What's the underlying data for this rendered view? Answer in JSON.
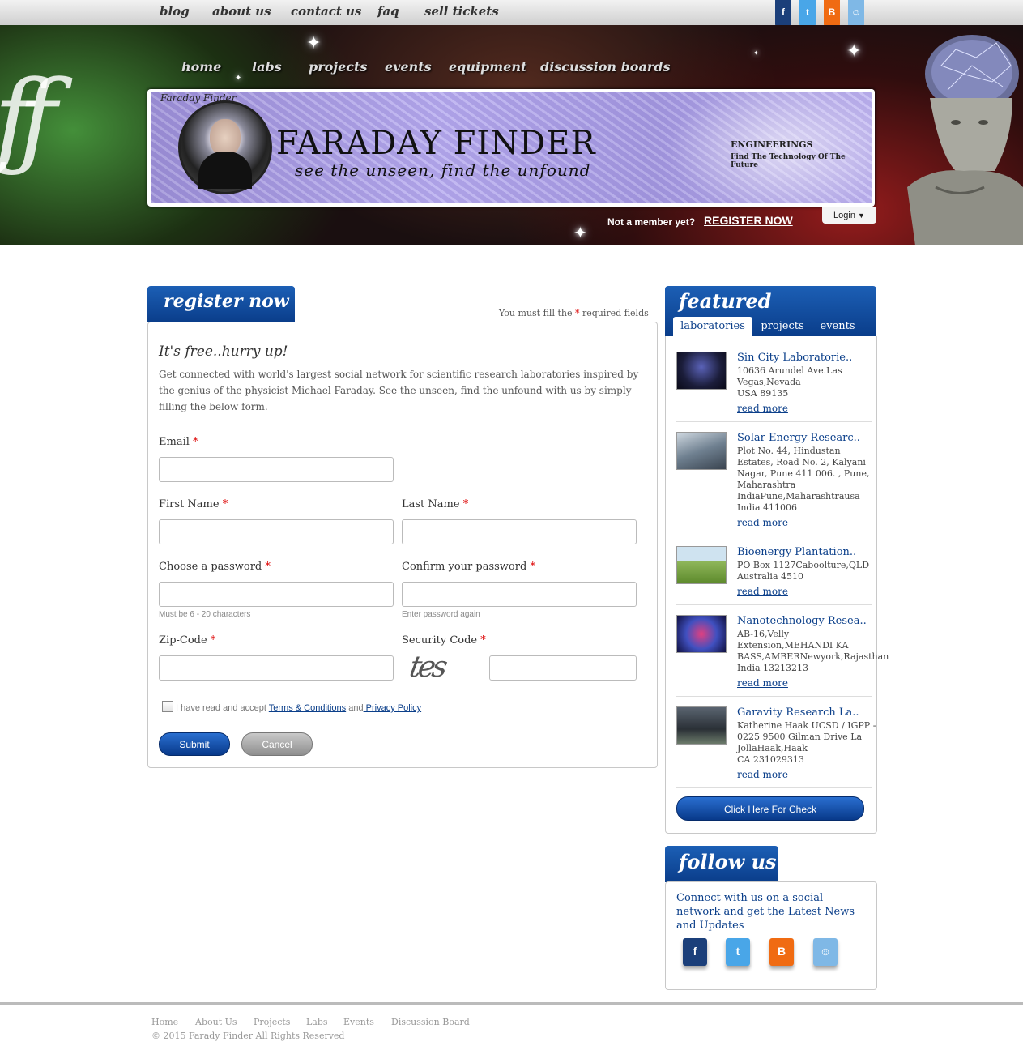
{
  "top_nav": {
    "items": [
      "blog",
      "about us",
      "contact us",
      "faq",
      "sell tickets"
    ]
  },
  "social_top": [
    {
      "icon": "facebook-icon",
      "glyph": "f",
      "color": "#1b3f7a"
    },
    {
      "icon": "twitter-icon",
      "glyph": "t",
      "color": "#49a6e8"
    },
    {
      "icon": "blogger-icon",
      "glyph": "B",
      "color": "#f06b12"
    },
    {
      "icon": "reddit-icon",
      "glyph": "☺",
      "color": "#7fb8e6"
    }
  ],
  "main_nav": {
    "items": [
      "home",
      "labs",
      "projects",
      "events",
      "equipment",
      "discussion boards"
    ]
  },
  "banner": {
    "arc_text": "Faraday Finder",
    "brand": "FARADAY FINDER",
    "tagline": "see the unseen,  find the unfound",
    "section": "ENGINEERINGS",
    "section_sub": "Find The Technology Of The Future"
  },
  "header": {
    "member_text": "Not a member yet?",
    "register_link": "REGISTER NOW",
    "login_label": "Login"
  },
  "register": {
    "tab_title": "register now",
    "required_prefix": "You must fill the",
    "required_suffix": "required fields",
    "heading": "It's free..hurry up!",
    "intro": "Get connected with world's largest social network for scientific research laboratories inspired by the genius of the physicist Michael Faraday. See the unseen, find the unfound with us by simply filling the below form.",
    "fields": {
      "email": "Email",
      "first_name": "First Name",
      "last_name": "Last Name",
      "password": "Choose a password",
      "confirm_password": "Confirm your password",
      "zip": "Zip-Code",
      "security": "Security Code"
    },
    "password_hint": "Must be 6 - 20 characters",
    "confirm_hint": "Enter password again",
    "captcha_text": "tes",
    "accept_prefix": "I have read and accept",
    "terms_link": "Terms & Conditions",
    "and_text": "and",
    "privacy_link": " Privacy Policy",
    "submit": "Submit",
    "cancel": "Cancel"
  },
  "featured": {
    "title": "featured",
    "tabs": [
      "laboratories",
      "projects",
      "events"
    ],
    "active_tab": "laboratories",
    "items": [
      {
        "title": "Sin City Laboratorie..",
        "address": "10636 Arundel Ave.Las Vegas,Nevada\nUSA 89135",
        "more": "read more"
      },
      {
        "title": "Solar Energy Researc..",
        "address": "Plot No. 44, Hindustan Estates, Road No. 2, Kalyani Nagar, Pune 411 006. , Pune, Maharashtra IndiaPune,Maharashtrausa\nIndia 411006",
        "more": "read more"
      },
      {
        "title": "Bioenergy Plantation..",
        "address": "PO Box 1127Caboolture,QLD\nAustralia 4510",
        "more": "read more"
      },
      {
        "title": "Nanotechnology Resea..",
        "address": "AB-16,Velly Extension,MEHANDI KA BASS,AMBERNewyork,Rajasthan\nIndia 13213213",
        "more": "read more"
      },
      {
        "title": "Garavity Research La..",
        "address": "Katherine Haak UCSD / IGPP - 0225 9500 Gilman Drive La JollaHaak,Haak\nCA 231029313",
        "more": "read more"
      }
    ],
    "check_button": "Click Here For Check"
  },
  "follow": {
    "title": "follow us",
    "text": "Connect with us on a social network and get the Latest News and Updates",
    "icons": [
      {
        "icon": "facebook-icon",
        "glyph": "f",
        "color": "#1b3f7a"
      },
      {
        "icon": "twitter-icon",
        "glyph": "t",
        "color": "#49a6e8"
      },
      {
        "icon": "blogger-icon",
        "glyph": "B",
        "color": "#f06b12"
      },
      {
        "icon": "reddit-icon",
        "glyph": "☺",
        "color": "#7fb8e6"
      }
    ]
  },
  "footer": {
    "links": [
      "Home",
      "About Us",
      "Projects",
      "Labs",
      "Events",
      "Discussion Board"
    ],
    "copyright": "© 2015 Farady Finder All Rights Reserved"
  }
}
